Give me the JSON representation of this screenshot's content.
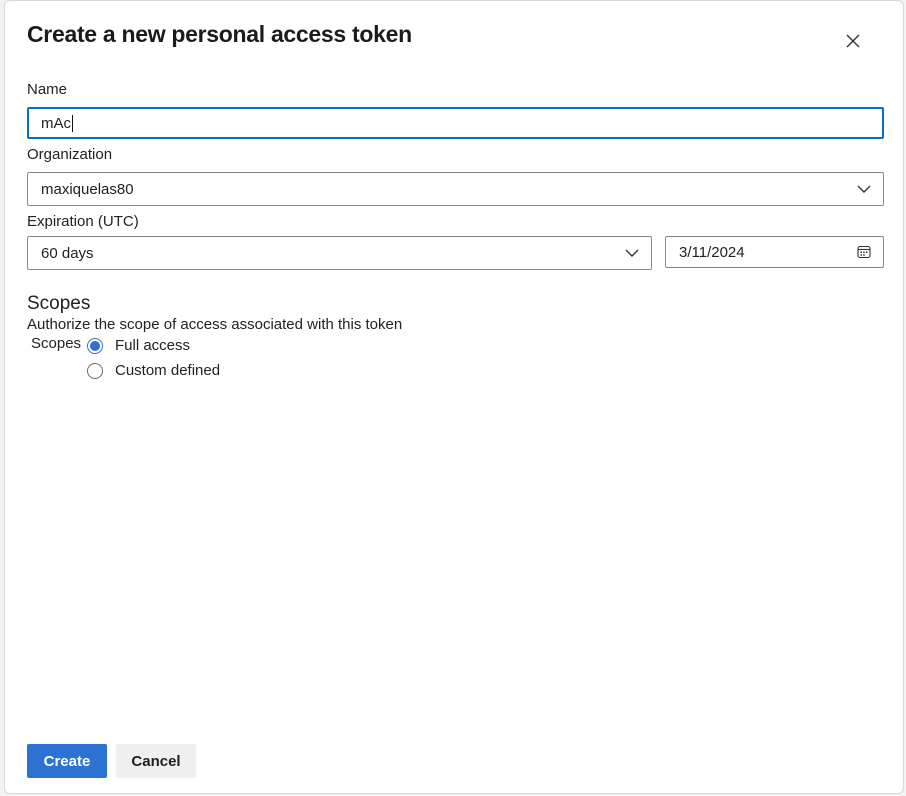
{
  "dialog": {
    "title": "Create a new personal access token",
    "close_icon": "close-icon"
  },
  "form": {
    "name_label": "Name",
    "name_value": "mAc",
    "organization_label": "Organization",
    "organization_value": "maxiquelas80",
    "expiration_label": "Expiration (UTC)",
    "expiration_value": "60 days",
    "expiration_date": "3/11/2024",
    "calendar_icon": "calendar-icon",
    "dropdown_icon": "chevron-down-icon"
  },
  "scopes": {
    "heading": "Scopes",
    "description": "Authorize the scope of access associated with this token",
    "inline_label": "Scopes",
    "options": [
      {
        "label": "Full access",
        "checked": true
      },
      {
        "label": "Custom defined",
        "checked": false
      }
    ]
  },
  "actions": {
    "create_label": "Create",
    "cancel_label": "Cancel"
  },
  "colors": {
    "accent": "#2b72d2",
    "focus_border": "#0f6cbd"
  }
}
